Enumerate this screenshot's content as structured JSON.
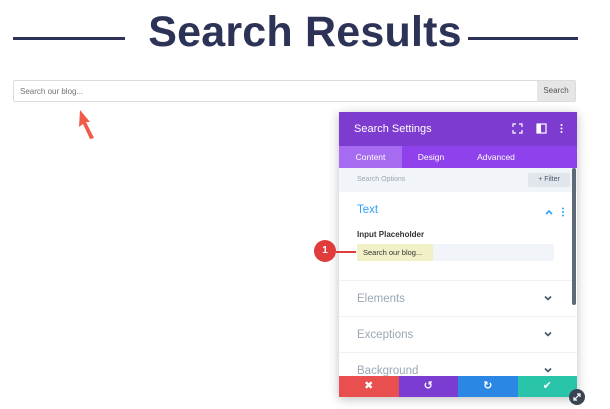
{
  "page": {
    "title": "Search Results",
    "search": {
      "placeholder": "Search our blog...",
      "button_label": "Search"
    }
  },
  "panel": {
    "title": "Search Settings",
    "header_icons": [
      "expand-icon",
      "sidebar-icon",
      "more-vertical-icon"
    ],
    "tabs": [
      {
        "label": "Content",
        "active": true
      },
      {
        "label": "Design",
        "active": false
      },
      {
        "label": "Advanced",
        "active": false
      }
    ],
    "search_options_label": "Search Options",
    "filter_label": "+ Filter",
    "sections": {
      "text": {
        "label": "Text",
        "field_label": "Input Placeholder",
        "field_value": "Search our blog..."
      },
      "collapsed": [
        "Elements",
        "Exceptions",
        "Background"
      ]
    },
    "footer": {
      "buttons": [
        {
          "icon": "close-icon",
          "glyph": "✖",
          "color": "#ea4f4f"
        },
        {
          "icon": "undo-icon",
          "glyph": "↺",
          "color": "#7b3cd2"
        },
        {
          "icon": "redo-icon",
          "glyph": "↻",
          "color": "#2b87e3"
        },
        {
          "icon": "check-icon",
          "glyph": "✔",
          "color": "#29c4a9"
        }
      ]
    }
  },
  "annotation": {
    "step_number": "1"
  },
  "colors": {
    "heading": "#2c3357",
    "panel_header": "#7e3bd0",
    "tabs_bg": "#8f42ec",
    "accent_blue": "#2ea3f2",
    "marker_red": "#e03c3c"
  }
}
